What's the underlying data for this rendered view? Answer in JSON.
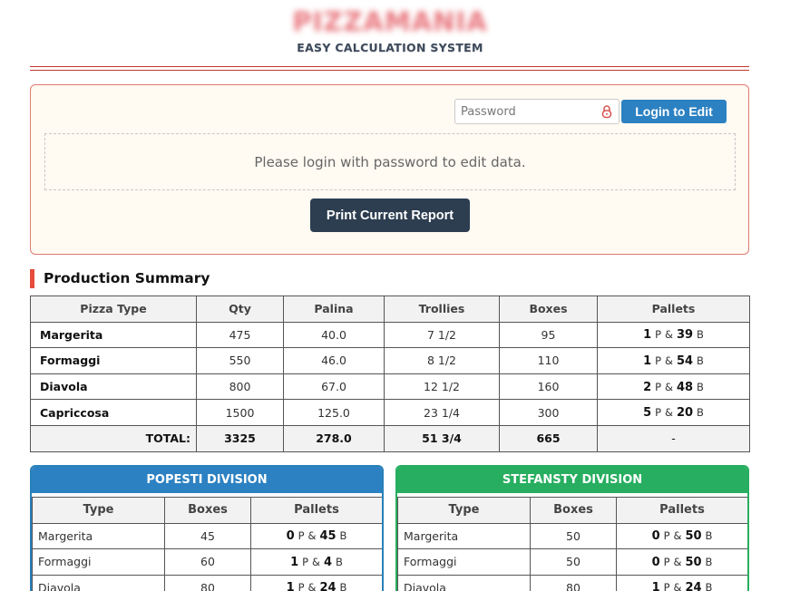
{
  "brand": {
    "title": "PIZZAMANIA",
    "subtitle": "EASY CALCULATION SYSTEM"
  },
  "login": {
    "password_placeholder": "Password",
    "login_label": "Login to Edit",
    "notice": "Please login with password to edit data.",
    "print_label": "Print Current Report"
  },
  "summary": {
    "heading": "Production Summary",
    "columns": [
      "Pizza Type",
      "Qty",
      "Palina",
      "Trollies",
      "Boxes",
      "Pallets"
    ],
    "rows": [
      {
        "name": "Margerita",
        "qty": "475",
        "palina": "40.0",
        "trollies": "7 1/2",
        "boxes": "95",
        "p": "1",
        "b": "39"
      },
      {
        "name": "Formaggi",
        "qty": "550",
        "palina": "46.0",
        "trollies": "8 1/2",
        "boxes": "110",
        "p": "1",
        "b": "54"
      },
      {
        "name": "Diavola",
        "qty": "800",
        "palina": "67.0",
        "trollies": "12 1/2",
        "boxes": "160",
        "p": "2",
        "b": "48"
      },
      {
        "name": "Capriccosa",
        "qty": "1500",
        "palina": "125.0",
        "trollies": "23 1/4",
        "boxes": "300",
        "p": "5",
        "b": "20"
      }
    ],
    "total": {
      "label": "TOTAL:",
      "qty": "3325",
      "palina": "278.0",
      "trollies": "51 3/4",
      "boxes": "665",
      "pallets": "-"
    }
  },
  "pallet_units": {
    "p": "P",
    "amp": "&",
    "b": "B"
  },
  "divisions": [
    {
      "title": "POPESTI DIVISION",
      "accent": "#2c81c2",
      "columns": [
        "Type",
        "Boxes",
        "Pallets"
      ],
      "rows": [
        {
          "name": "Margerita",
          "boxes": "45",
          "p": "0",
          "b": "45"
        },
        {
          "name": "Formaggi",
          "boxes": "60",
          "p": "1",
          "b": "4"
        },
        {
          "name": "Diavola",
          "boxes": "80",
          "p": "1",
          "b": "24"
        }
      ]
    },
    {
      "title": "STEFANSTY DIVISION",
      "accent": "#27ae60",
      "columns": [
        "Type",
        "Boxes",
        "Pallets"
      ],
      "rows": [
        {
          "name": "Margerita",
          "boxes": "50",
          "p": "0",
          "b": "50"
        },
        {
          "name": "Formaggi",
          "boxes": "50",
          "p": "0",
          "b": "50"
        },
        {
          "name": "Diavola",
          "boxes": "80",
          "p": "1",
          "b": "24"
        }
      ]
    }
  ],
  "colors": {
    "accent_red": "#e74c3c",
    "blue": "#2c81c2",
    "green": "#27ae60",
    "dark": "#2c3e50"
  }
}
